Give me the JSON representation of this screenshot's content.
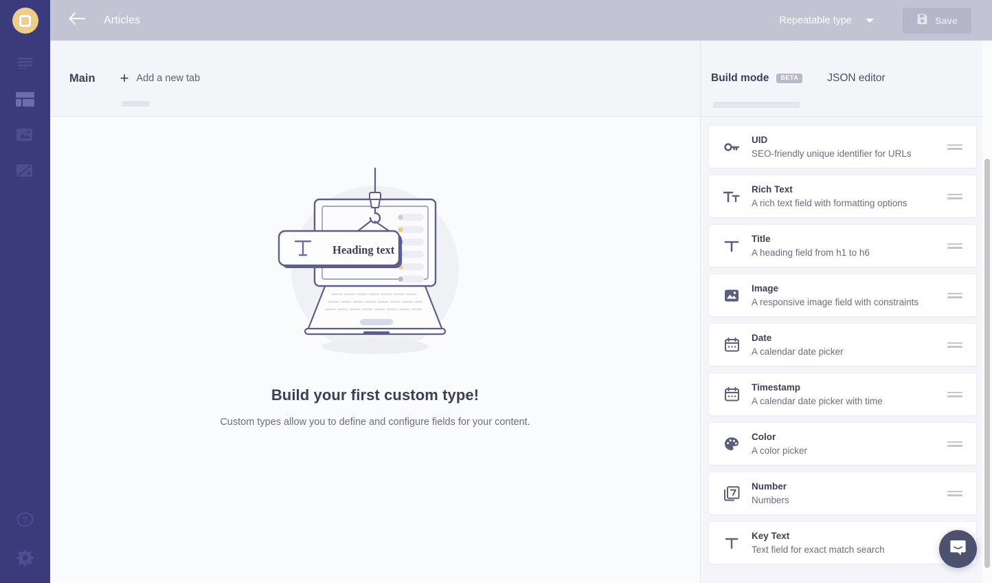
{
  "app": {
    "logo_icon": "prismic-logo-icon",
    "accent_purple": "#3b3a7a",
    "accent_gold": "#eece87",
    "topbar_bg": "#c2c3d3"
  },
  "sidebar": {
    "top_items": [
      {
        "name": "documents",
        "icon": "document-lines-icon",
        "active": false
      },
      {
        "name": "custom-types",
        "icon": "layout-grid-icon",
        "active": true
      },
      {
        "name": "media-library",
        "icon": "image-icon",
        "active": false
      },
      {
        "name": "slices",
        "icon": "slices-icon",
        "active": false
      }
    ],
    "bottom_items": [
      {
        "name": "help",
        "icon": "help-circle-icon"
      },
      {
        "name": "settings",
        "icon": "gear-icon"
      }
    ]
  },
  "topbar": {
    "back_icon": "arrow-left-icon",
    "title": "Articles",
    "type_selector": {
      "label": "Repeatable type",
      "icon": "chevron-down-icon"
    },
    "save": {
      "label": "Save",
      "icon": "floppy-disk-save-icon"
    }
  },
  "main": {
    "tabs": [
      {
        "label": "Main",
        "active": true
      }
    ],
    "add_tab": {
      "label": "Add a new tab",
      "icon": "plus-icon"
    },
    "illustration": {
      "name": "laptop-crane-heading-illustration",
      "card_label": "Heading text",
      "card_icon": "title-T-icon"
    },
    "empty_state": {
      "title": "Build your first custom type!",
      "subtitle": "Custom types allow you to define and configure fields for your content."
    }
  },
  "right_panel": {
    "tabs": [
      {
        "label": "Build mode",
        "badge": "BETA",
        "active": true
      },
      {
        "label": "JSON editor",
        "badge": "",
        "active": false
      }
    ],
    "fields": [
      {
        "title": "UID",
        "desc": "SEO-friendly unique identifier for URLs",
        "icon": "key-icon"
      },
      {
        "title": "Rich Text",
        "desc": "A rich text field with formatting options",
        "icon": "rich-text-Tt-icon"
      },
      {
        "title": "Title",
        "desc": "A heading field from h1 to h6",
        "icon": "title-T-icon"
      },
      {
        "title": "Image",
        "desc": "A responsive image field with constraints",
        "icon": "image-icon"
      },
      {
        "title": "Date",
        "desc": "A calendar date picker",
        "icon": "calendar-icon"
      },
      {
        "title": "Timestamp",
        "desc": "A calendar date picker with time",
        "icon": "calendar-clock-icon"
      },
      {
        "title": "Color",
        "desc": "A color picker",
        "icon": "palette-icon"
      },
      {
        "title": "Number",
        "desc": "Numbers",
        "icon": "number-7-icon"
      },
      {
        "title": "Key Text",
        "desc": "Text field for exact match search",
        "icon": "key-text-T-icon"
      }
    ],
    "drag_handle_icon": "drag-handle-icon"
  },
  "chat": {
    "icon": "intercom-chat-icon"
  }
}
